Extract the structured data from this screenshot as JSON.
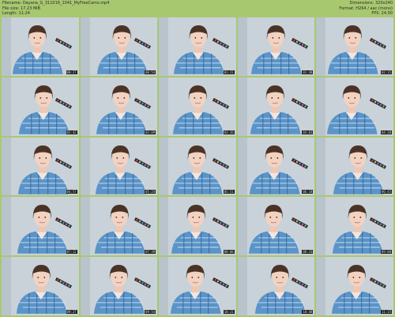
{
  "info": {
    "filename_label": "Filename:",
    "filename": "Dayana_G_311016_1041_MyFreeCams.mp4",
    "filesize_label": "File size:",
    "filesize": "17.23 MiB",
    "length_label": "Length:",
    "length": "11:24",
    "dimensions_label": "Dimensions:",
    "dimensions": "320x240",
    "format_label": "Format:",
    "format": "H264 / aac (mono)",
    "fps_label": "FPS:",
    "fps": "24.00"
  },
  "colors": {
    "background": "#a8c870",
    "wall": "#c9d2d9",
    "shirt": "#5a94c8",
    "hair": "#4a3326"
  },
  "thumbnails": [
    {
      "time": "00:27"
    },
    {
      "time": "00:54"
    },
    {
      "time": "01:21"
    },
    {
      "time": "01:48"
    },
    {
      "time": "02:15"
    },
    {
      "time": "02:42"
    },
    {
      "time": "03:09"
    },
    {
      "time": "03:36"
    },
    {
      "time": "04:03"
    },
    {
      "time": "04:30"
    },
    {
      "time": "04:57"
    },
    {
      "time": "05:24"
    },
    {
      "time": "05:51"
    },
    {
      "time": "06:18"
    },
    {
      "time": "06:45"
    },
    {
      "time": "07:12"
    },
    {
      "time": "07:39"
    },
    {
      "time": "08:06"
    },
    {
      "time": "08:33"
    },
    {
      "time": "09:00"
    },
    {
      "time": "09:27"
    },
    {
      "time": "09:54"
    },
    {
      "time": "10:21"
    },
    {
      "time": "10:48"
    },
    {
      "time": "11:15"
    }
  ]
}
